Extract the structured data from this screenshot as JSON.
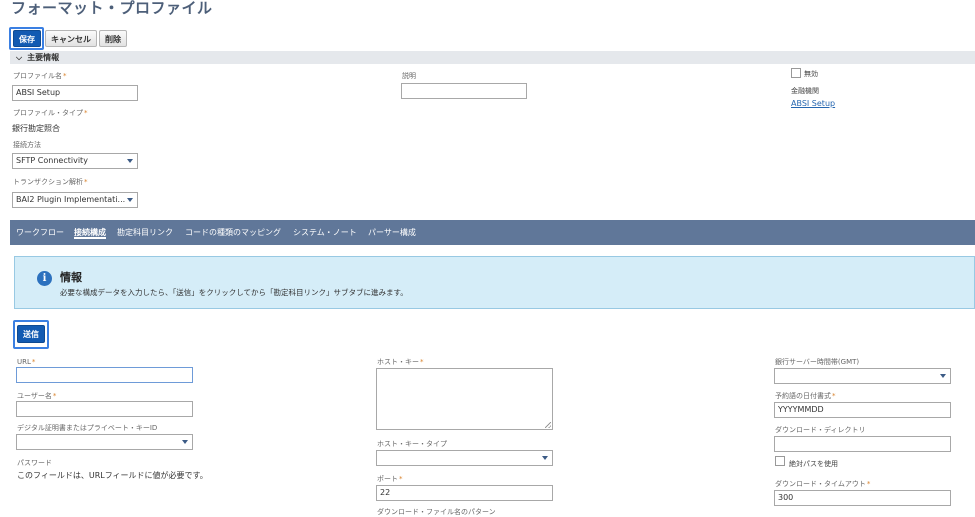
{
  "page": {
    "title": "フォーマット・プロファイル"
  },
  "toolbar": {
    "save": "保存",
    "cancel": "キャンセル",
    "delete": "削除"
  },
  "primary_section": {
    "title": "主要情報"
  },
  "fields": {
    "profile_name": {
      "label": "プロファイル名",
      "value": "ABSI Setup",
      "required": "*"
    },
    "description": {
      "label": "説明",
      "value": ""
    },
    "inactive": {
      "label": "無効",
      "checked": false
    },
    "financial_institution": {
      "label": "金融機関",
      "value": "ABSI Setup"
    },
    "profile_type": {
      "label": "プロファイル・タイプ",
      "value": "銀行勘定照合",
      "required": "*"
    },
    "connection_method": {
      "label": "接続方法",
      "value": "SFTP Connectivity"
    },
    "transaction_parser": {
      "label": "トランザクション解析",
      "value": "BAI2 Plugin Implementati...",
      "required": "*"
    }
  },
  "tabs": [
    {
      "label": "ワークフロー",
      "active": false
    },
    {
      "label": "接続構成",
      "active": true
    },
    {
      "label": "勘定科目リンク",
      "active": false
    },
    {
      "label": "コードの種類のマッピング",
      "active": false
    },
    {
      "label": "システム・ノート",
      "active": false
    },
    {
      "label": "パーサー構成",
      "active": false
    }
  ],
  "info": {
    "icon": "info-icon",
    "title": "情報",
    "message": "必要な構成データを入力したら、「送信」をクリックしてから「勘定科目リンク」サブタブに進みます。"
  },
  "submit_label": "送信",
  "connection": {
    "url": {
      "label": "URL",
      "required": "*",
      "value": ""
    },
    "username": {
      "label": "ユーザー名",
      "required": "*",
      "value": ""
    },
    "cert_key": {
      "label": "デジタル証明書またはプライベート・キーID",
      "value": ""
    },
    "password": {
      "label": "パスワード",
      "note": "このフィールドは、URLフィールドに値が必要です。"
    },
    "host_key": {
      "label": "ホスト・キー",
      "required": "*",
      "value": ""
    },
    "host_key_type": {
      "label": "ホスト・キー・タイプ",
      "value": ""
    },
    "port": {
      "label": "ポート",
      "required": "*",
      "value": "22"
    },
    "download_filename_pattern": {
      "label": "ダウンロード・ファイル名のパターン"
    },
    "bank_timezone": {
      "label": "銀行サーバー時間帯(GMT)",
      "value": ""
    },
    "date_format": {
      "label": "予約語の日付書式",
      "required": "*",
      "value": "YYYYMMDD"
    },
    "download_directory": {
      "label": "ダウンロード・ディレクトリ",
      "value": ""
    },
    "absolute_path": {
      "label": "絶対パスを使用",
      "checked": false
    },
    "download_timeout": {
      "label": "ダウンロード・タイムアウト",
      "required": "*",
      "value": "300"
    }
  },
  "colors": {
    "primary_button": "#125ab2",
    "tab_bar": "#607799",
    "highlight": "#3a7fe2",
    "info_bg": "#d5edf8",
    "required": "#d9822b"
  }
}
